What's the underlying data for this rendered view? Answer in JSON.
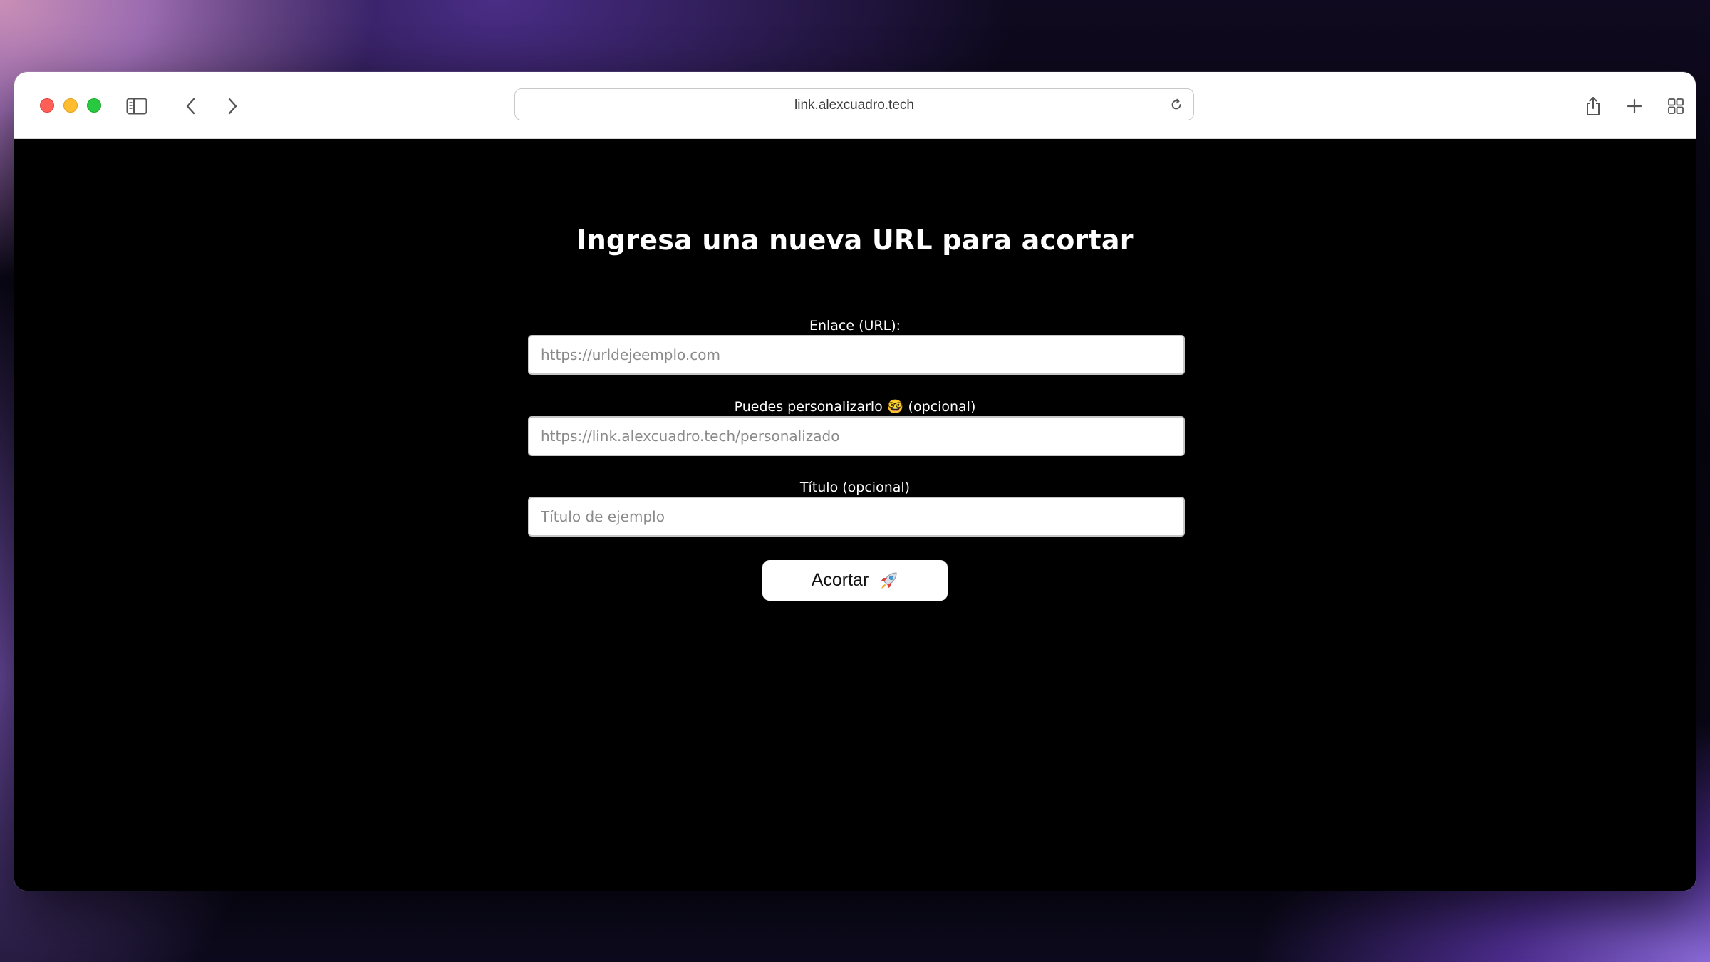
{
  "browser": {
    "url": "link.alexcuadro.tech",
    "traffic_lights": {
      "close": "#ff5f57",
      "minimize": "#febc2e",
      "zoom": "#28c840"
    },
    "icons": {
      "sidebar": "sidebar-icon",
      "back": "chevron-left-icon",
      "forward": "chevron-right-icon",
      "reload": "reload-icon",
      "share": "share-icon",
      "new_tab": "plus-icon",
      "tab_overview": "grid-icon"
    }
  },
  "page": {
    "background": "#000000",
    "title": "Ingresa una nueva URL para acortar",
    "form": {
      "url_label": "Enlace (URL):",
      "url_placeholder": "https://urldejeemplo.com",
      "custom_label": "Puedes personalizarlo 🤓 (opcional)",
      "custom_placeholder": "https://link.alexcuadro.tech/personalizado",
      "title_label": "Título (opcional)",
      "title_placeholder": "Título de ejemplo",
      "submit_label": "Acortar",
      "submit_icon": "rocket-icon"
    }
  }
}
